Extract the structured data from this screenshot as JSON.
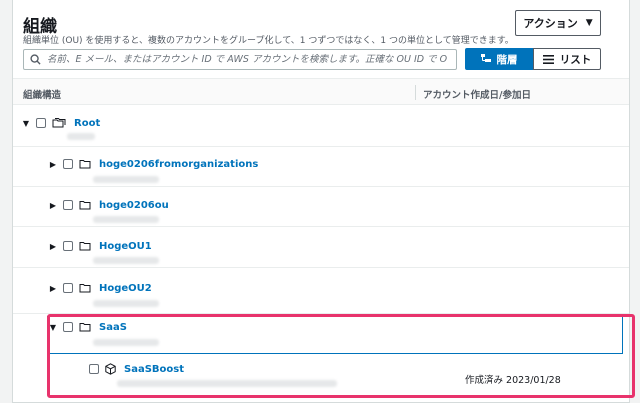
{
  "header": {
    "title": "組織",
    "description": "組織単位 (OU) を使用すると、複数のアカウントをグループ化して、1 つずつではなく、1 つの単位として管理できます。",
    "action_label": "アクション"
  },
  "search": {
    "placeholder": "名前、E メール、またはアカウント ID で AWS アカウントを検索します。正確な OU ID で OU を検索"
  },
  "view_toggle": {
    "hierarchy_label": "階層",
    "list_label": "リスト",
    "selected": "階層"
  },
  "columns": {
    "structure": "組織構造",
    "created": "アカウント作成日/参加日"
  },
  "tree": {
    "root": {
      "name": "Root",
      "expanded": true
    },
    "ous": [
      {
        "name": "hoge0206fromorganizations",
        "expanded": false
      },
      {
        "name": "hoge0206ou",
        "expanded": false
      },
      {
        "name": "HogeOU1",
        "expanded": false
      },
      {
        "name": "HogeOU2",
        "expanded": false
      },
      {
        "name": "SaaS",
        "expanded": true
      }
    ],
    "account": {
      "name": "SaaSBoost",
      "created": "作成済み 2023/01/28"
    }
  },
  "colors": {
    "link": "#0073bb",
    "highlight": "#e8336c",
    "primary": "#0073bb"
  }
}
